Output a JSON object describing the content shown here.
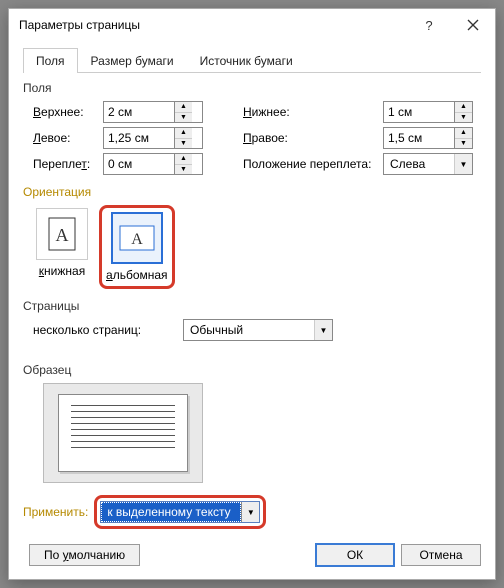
{
  "title": "Параметры страницы",
  "tabs": {
    "fields": "Поля",
    "paper": "Размер бумаги",
    "source": "Источник бумаги"
  },
  "groups": {
    "fields": "Поля",
    "orientation": "Ориентация",
    "pages": "Страницы",
    "preview": "Образец"
  },
  "margins": {
    "top_label": "Верхнее:",
    "top_val": "2 см",
    "left_label": "Левое:",
    "left_val": "1,25 см",
    "gutter_label": "Переплет:",
    "gutter_val": "0 см",
    "bottom_label": "Нижнее:",
    "bottom_val": "1 см",
    "right_label": "Правое:",
    "right_val": "1,5 см",
    "gutterpos_label": "Положение переплета:",
    "gutterpos_val": "Слева"
  },
  "orientation": {
    "portrait": "книжная",
    "landscape": "альбомная"
  },
  "pages": {
    "multi_label": "несколько страниц:",
    "multi_val": "Обычный"
  },
  "apply": {
    "label": "Применить:",
    "value": "к выделенному тексту"
  },
  "buttons": {
    "default": "По умолчанию",
    "ok": "ОК",
    "cancel": "Отмена"
  },
  "underline_chars": {
    "top": "В",
    "left": "Л",
    "gutter": "т",
    "bottom": "Н",
    "right": "П",
    "gutterpos": "П",
    "portrait": "к",
    "landscape": "а",
    "default": "у",
    "apply": "П"
  }
}
